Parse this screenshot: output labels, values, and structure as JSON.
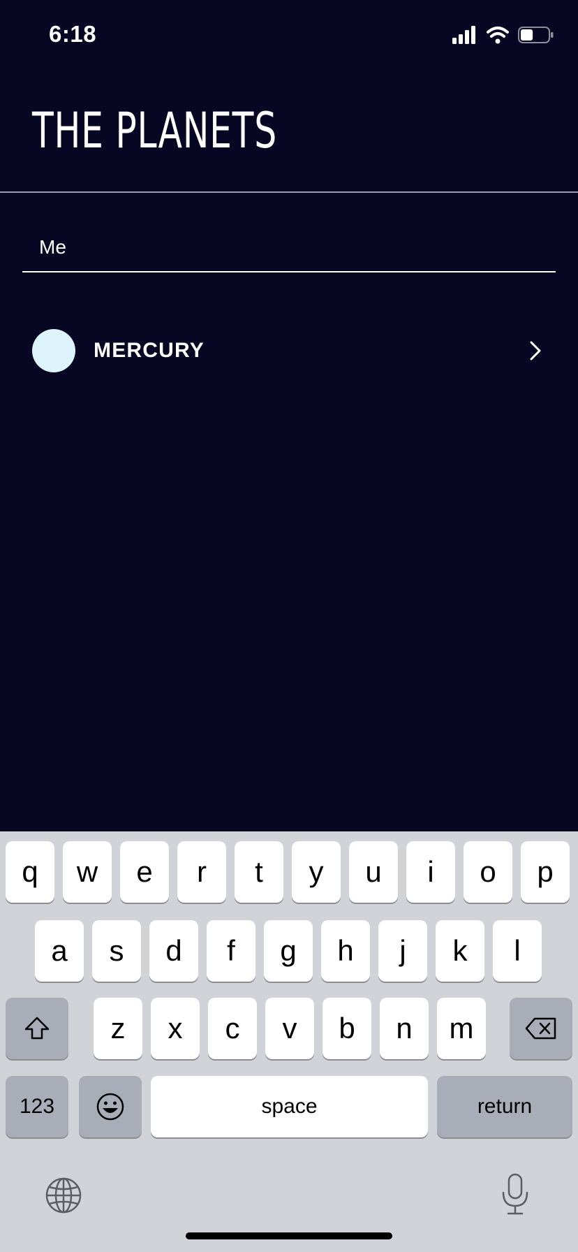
{
  "status_bar": {
    "time": "6:18",
    "icons": [
      "cellular-signal-icon",
      "wifi-icon",
      "battery-icon"
    ],
    "battery_level": 0.45
  },
  "header": {
    "title": "THE PLANETS"
  },
  "search": {
    "value": "Me",
    "placeholder": ""
  },
  "results": [
    {
      "name": "MERCURY",
      "color": "#DEF4FC",
      "icon": "chevron-right-icon"
    }
  ],
  "keyboard": {
    "row1": [
      "q",
      "w",
      "e",
      "r",
      "t",
      "y",
      "u",
      "i",
      "o",
      "p"
    ],
    "row2": [
      "a",
      "s",
      "d",
      "f",
      "g",
      "h",
      "j",
      "k",
      "l"
    ],
    "row3": [
      "z",
      "x",
      "c",
      "v",
      "b",
      "n",
      "m"
    ],
    "shift_icon": "shift-icon",
    "delete_icon": "delete-icon",
    "numbers_label": "123",
    "emoji_icon": "emoji-icon",
    "space_label": "space",
    "return_label": "return",
    "globe_icon": "globe-icon",
    "mic_icon": "microphone-icon"
  },
  "colors": {
    "background": "#070724",
    "text": "#FFFFFF",
    "keyboard_background": "#D1D3D9",
    "key": "#FFFFFF",
    "dark_key": "#A9ADB8"
  }
}
